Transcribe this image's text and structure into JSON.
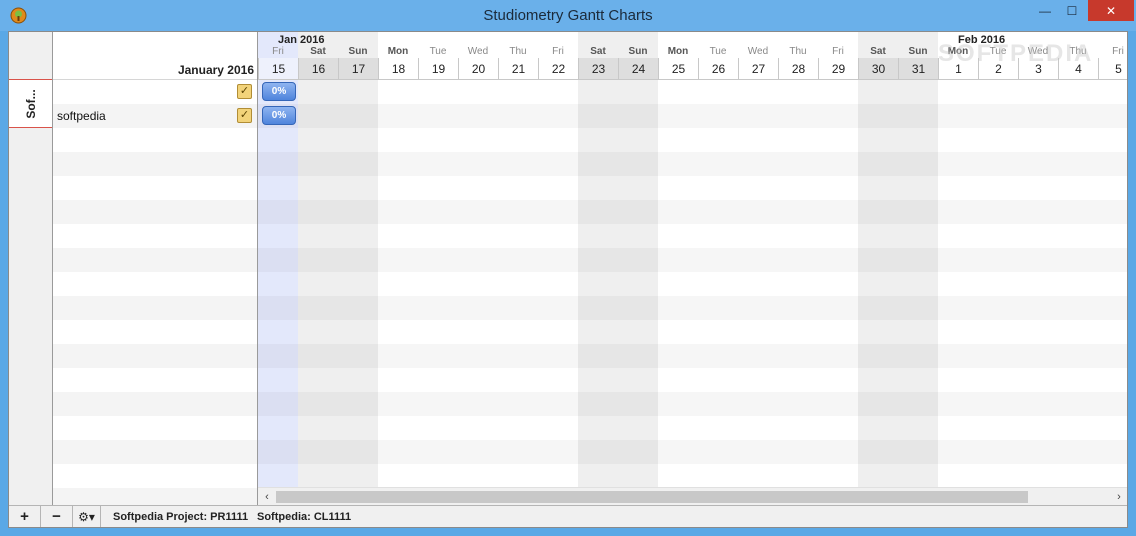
{
  "window": {
    "title": "Studiometry Gantt Charts",
    "min_glyph": "—",
    "max_glyph": "☐",
    "close_glyph": "✕"
  },
  "sidebar": {
    "tabs": [
      {
        "label": "Sof..."
      }
    ]
  },
  "task_list": {
    "header_month": "January 2016",
    "rows": [
      {
        "name": "",
        "checked": true,
        "progress": "0%"
      },
      {
        "name": "softpedia",
        "checked": true,
        "progress": "0%"
      }
    ]
  },
  "timeline": {
    "months": [
      {
        "label": "Jan 2016",
        "start_index": 0
      },
      {
        "label": "Feb 2016",
        "start_index": 17
      }
    ],
    "today_index": 0,
    "days": [
      {
        "dow": "Fri",
        "day": "15",
        "weekend": false
      },
      {
        "dow": "Sat",
        "day": "16",
        "weekend": true
      },
      {
        "dow": "Sun",
        "day": "17",
        "weekend": true
      },
      {
        "dow": "Mon",
        "day": "18",
        "weekend": false
      },
      {
        "dow": "Tue",
        "day": "19",
        "weekend": false
      },
      {
        "dow": "Wed",
        "day": "20",
        "weekend": false
      },
      {
        "dow": "Thu",
        "day": "21",
        "weekend": false
      },
      {
        "dow": "Fri",
        "day": "22",
        "weekend": false
      },
      {
        "dow": "Sat",
        "day": "23",
        "weekend": true
      },
      {
        "dow": "Sun",
        "day": "24",
        "weekend": true
      },
      {
        "dow": "Mon",
        "day": "25",
        "weekend": false
      },
      {
        "dow": "Tue",
        "day": "26",
        "weekend": false
      },
      {
        "dow": "Wed",
        "day": "27",
        "weekend": false
      },
      {
        "dow": "Thu",
        "day": "28",
        "weekend": false
      },
      {
        "dow": "Fri",
        "day": "29",
        "weekend": false
      },
      {
        "dow": "Sat",
        "day": "30",
        "weekend": true
      },
      {
        "dow": "Sun",
        "day": "31",
        "weekend": true
      },
      {
        "dow": "Mon",
        "day": "1",
        "weekend": false
      },
      {
        "dow": "Tue",
        "day": "2",
        "weekend": false
      },
      {
        "dow": "Wed",
        "day": "3",
        "weekend": false
      },
      {
        "dow": "Thu",
        "day": "4",
        "weekend": false
      },
      {
        "dow": "Fri",
        "day": "5",
        "weekend": false
      }
    ],
    "watermark": "SOFTPEDIA"
  },
  "status": {
    "add_label": "+",
    "remove_label": "−",
    "settings_glyph": "⚙▾",
    "project_text": "Softpedia Project: PR1111",
    "client_text": "Softpedia: CL1111"
  },
  "colors": {
    "titlebar": "#6ab0ea",
    "close_button": "#c7392c",
    "task_bar": "#4f84dc",
    "tab_accent": "#d9534a"
  }
}
